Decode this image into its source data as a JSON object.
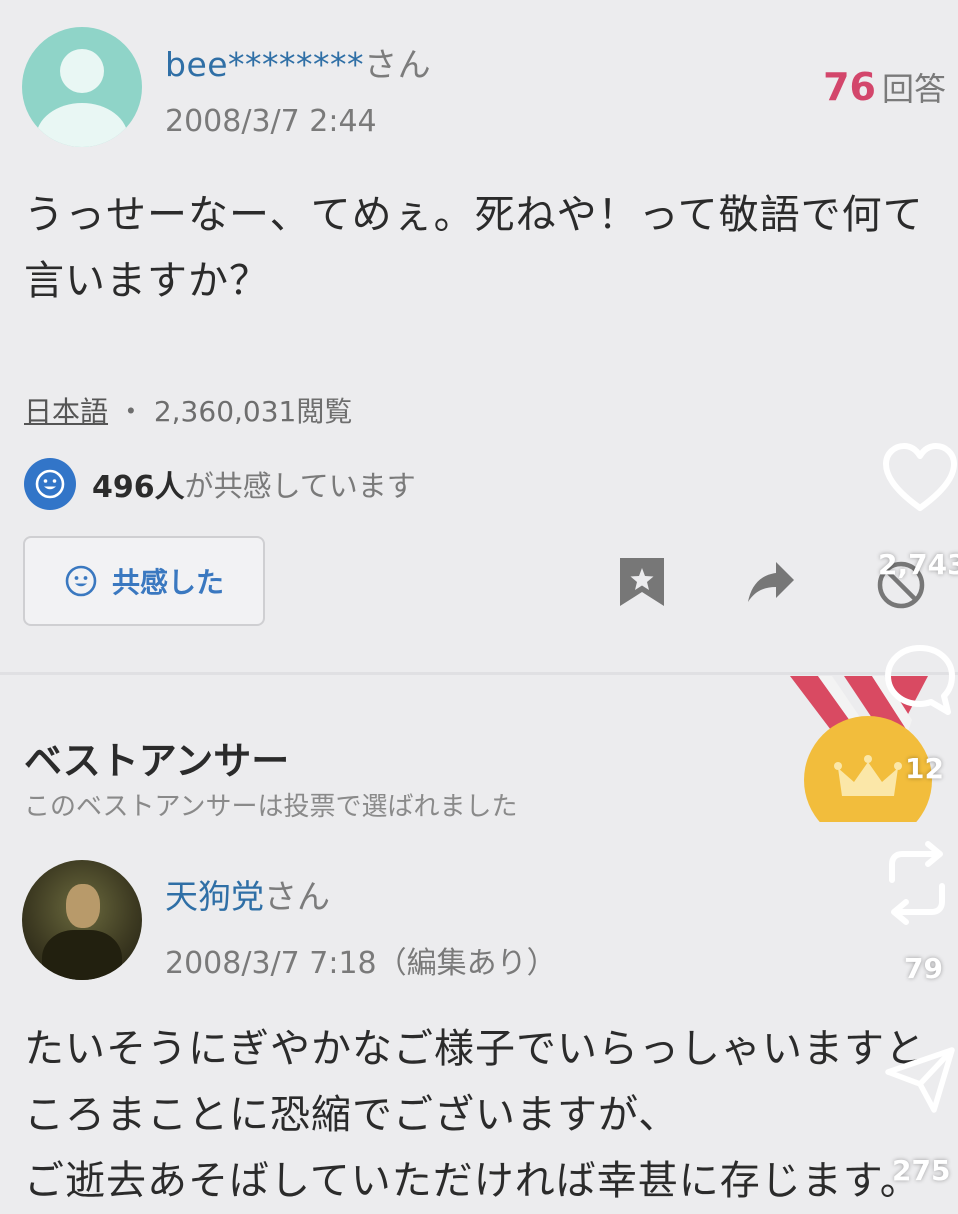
{
  "question": {
    "username": "bee********",
    "honorific": "さん",
    "date": "2008/3/7 2:44",
    "answer_count": "76",
    "answer_label": "回答",
    "text_line1": "うっせーなー、てめぇ。死ねや！って敬語で何て",
    "text_line2": "言いますか？",
    "category": "日本語",
    "separator": "・",
    "views": "2,360,031閲覧",
    "empathy_count": "496人",
    "empathy_text": "が共感しています",
    "empathy_button": "共感した"
  },
  "best_answer": {
    "title": "ベストアンサー",
    "subtitle": "このベストアンサーは投票で選ばれました",
    "username": "天狗党",
    "honorific": "さん",
    "date": "2008/3/7 7:18（編集あり）",
    "text_line1": "たいそうにぎやかなご様子でいらっしゃいますと",
    "text_line2": "ころまことに恐縮でございますが、",
    "text_line3": "ご逝去あそばしていただければ幸甚に存じます。"
  },
  "side_overlay": {
    "like_count": "2,743",
    "comment_count": "12",
    "repost_count": "79",
    "share_count": "275"
  },
  "colors": {
    "background": "#ececee",
    "link_blue": "#2f6fa6",
    "accent_pink": "#d3466b",
    "empathy_blue": "#3275c8",
    "medal_gold": "#f2bd3c"
  },
  "icons": {
    "avatar": "default-user-icon",
    "empathy": "smile-icon",
    "bookmark": "bookmark-star-icon",
    "share": "share-arrow-icon",
    "report": "prohibited-icon",
    "medal": "crown-medal-icon",
    "like": "heart-icon",
    "comment": "chat-bubble-icon",
    "repost": "repost-icon",
    "send": "send-icon"
  }
}
